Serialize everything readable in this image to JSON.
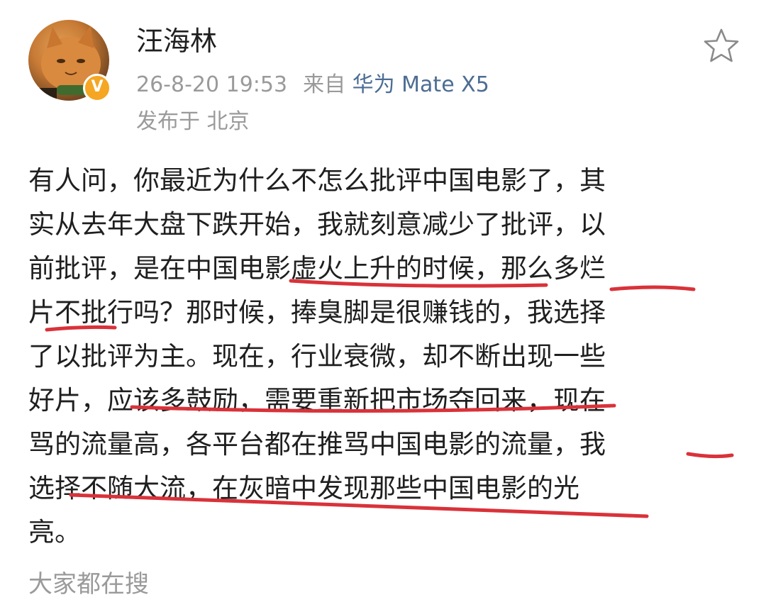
{
  "post": {
    "author": "汪海林",
    "verified_badge": "V",
    "timestamp": "26-8-20 19:53",
    "source_prefix": "来自",
    "device": "华为 Mate X5",
    "location_prefix": "发布于",
    "location": "北京",
    "body_lines": [
      "有人问，你最近为什么不怎么批评中国电影了，其",
      "实从去年大盘下跌开始，我就刻意减少了批评，以",
      "前批评，是在中国电影虚火上升的时候，那么多烂",
      "片不批行吗？那时候，捧臭脚是很赚钱的，我选择",
      "了以批评为主。现在，行业衰微，却不断出现一些",
      "好片，应该多鼓励，需要重新把市场夺回来，现在",
      "骂的流量高，各平台都在推骂中国电影的流量，我",
      "选择不随大流，在灰暗中发现那些中国电影的光",
      "亮。"
    ]
  },
  "footer": {
    "label": "大家都在搜"
  },
  "icons": {
    "favorite": "star-outline-icon",
    "verified": "verified-badge-icon"
  },
  "colors": {
    "underline": "#d9323a",
    "link": "#4c6d93",
    "meta": "#9a9a9a",
    "badge": "#f5a623"
  }
}
